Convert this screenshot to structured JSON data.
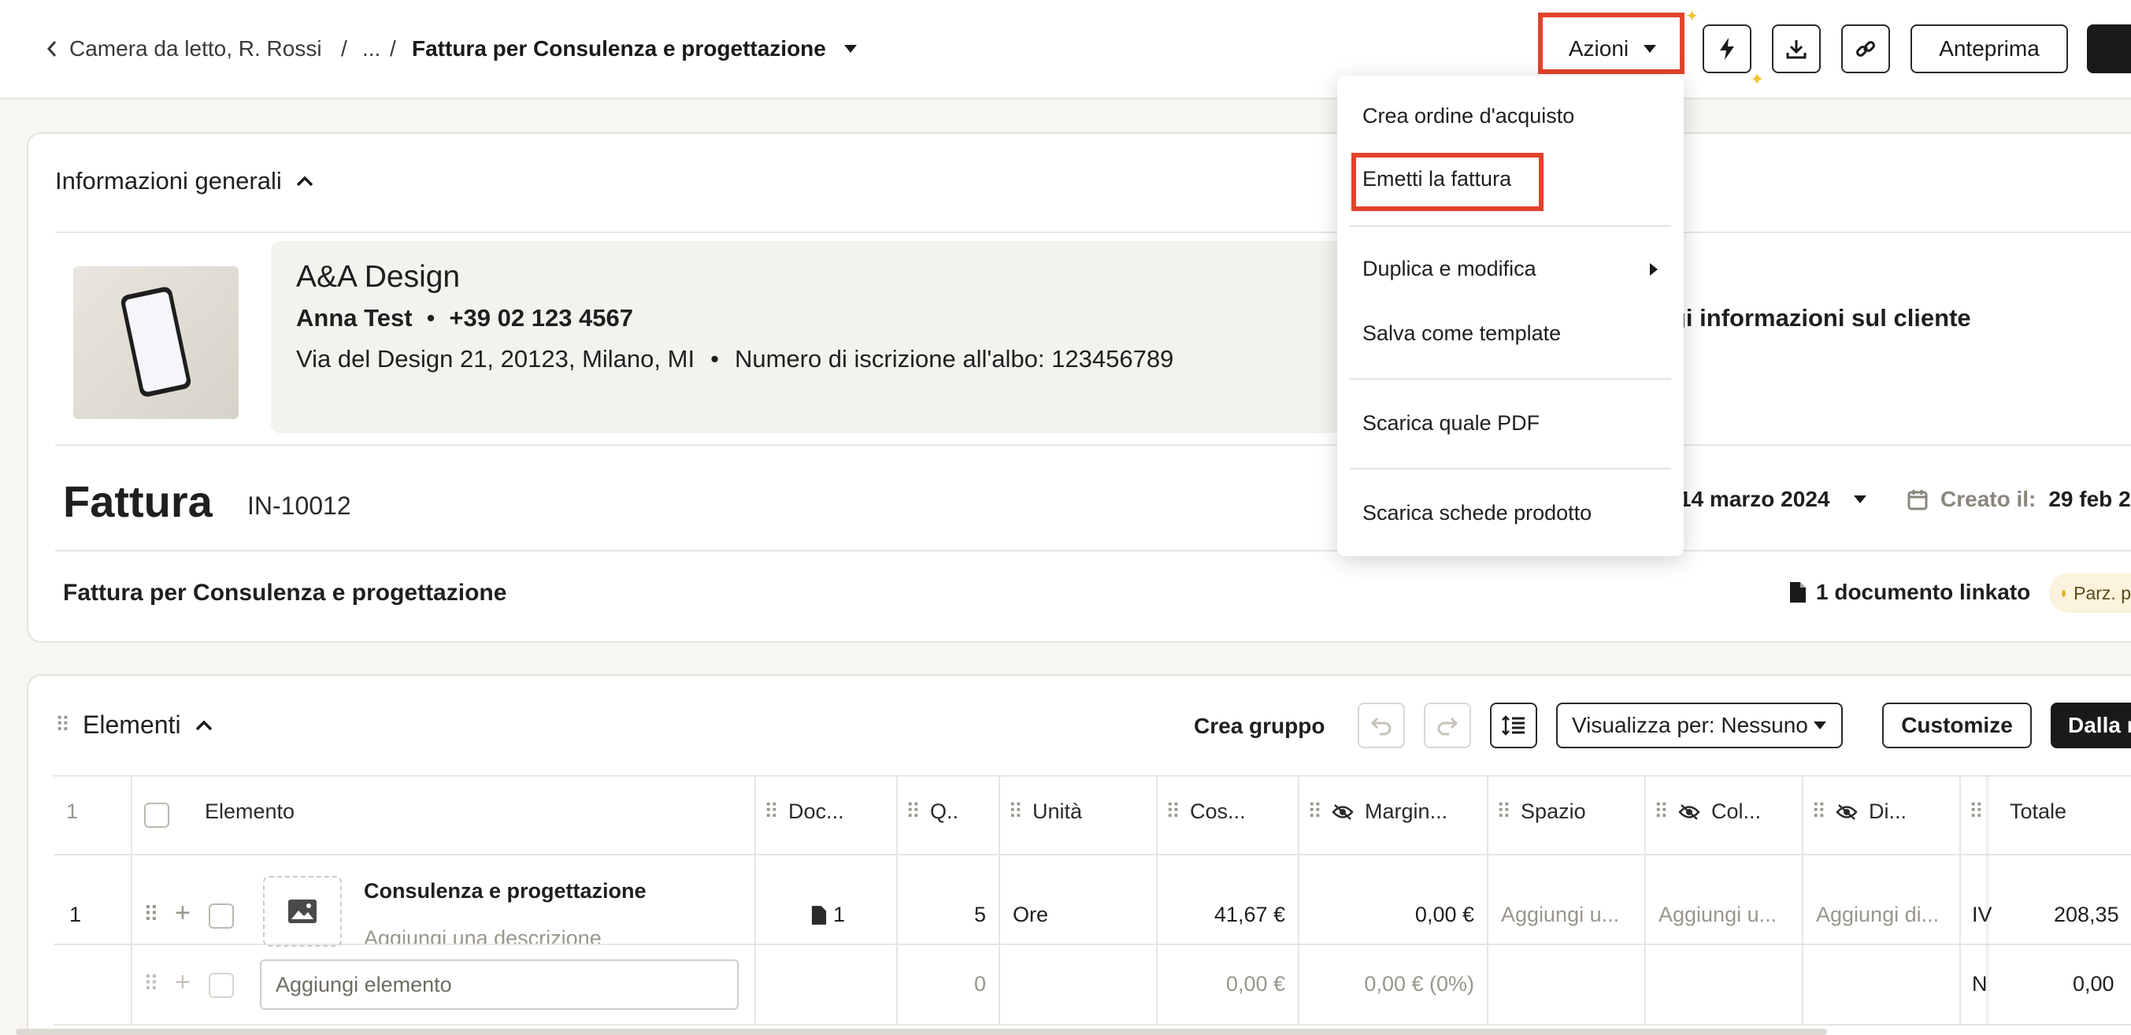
{
  "breadcrumb": {
    "back": "Camera da letto, R. Rossi",
    "sep1": "/",
    "ellipsis": "...",
    "sep2": "/",
    "current": "Fattura per Consulenza e progettazione"
  },
  "toolbar": {
    "actions": "Azioni",
    "preview": "Anteprima"
  },
  "menu": {
    "items": [
      "Crea ordine d'acquisto",
      "Emetti la fattura",
      "Duplica e modifica",
      "Salva come template",
      "Scarica quale PDF",
      "Scarica schede prodotto"
    ]
  },
  "general": {
    "title": "Informazioni generali",
    "company": "A&A Design",
    "contact_name": "Anna Test",
    "bullet": "•",
    "phone": "+39 02 123 4567",
    "address": "Via del Design 21, 20123, Milano, MI",
    "registration": "Numero di iscrizione all'albo: 123456789",
    "client_link": "gi informazioni sul cliente",
    "doc_type": "Fattura",
    "doc_number": "IN-10012",
    "date_value": "14 marzo 2024",
    "created_label": "Creato il:",
    "created_value": "29 feb 2",
    "subject": "Fattura per Consulenza e progettazione",
    "linked_docs": "1 documento linkato",
    "status_badge": "Parz. p"
  },
  "elements": {
    "title": "Elementi",
    "create_group": "Crea gruppo",
    "view_by": "Visualizza per: Nessuno",
    "customize": "Customize",
    "primary": "Dalla n",
    "header_count": "1",
    "columns": [
      "Elemento",
      "Doc...",
      "Q..",
      "Unità",
      "Cos...",
      "Margin...",
      "Spazio",
      "Col...",
      "Di...",
      "Totale"
    ],
    "row1": {
      "index": "1",
      "name": "Consulenza e progettazione",
      "description": "Aggiungi una descrizione",
      "docs": "1",
      "qty": "5",
      "unit": "Ore",
      "cost": "41,67 €",
      "margin": "0,00 €",
      "space": "Aggiungi u...",
      "color": "Aggiungi u...",
      "dim": "Aggiungi di...",
      "vat": "IV",
      "total": "208,35"
    },
    "row2": {
      "placeholder": "Aggiungi elemento",
      "qty": "0",
      "cost": "0,00 €",
      "margin": "0,00 € (0%)",
      "vat": "N",
      "total": "0,00"
    }
  }
}
